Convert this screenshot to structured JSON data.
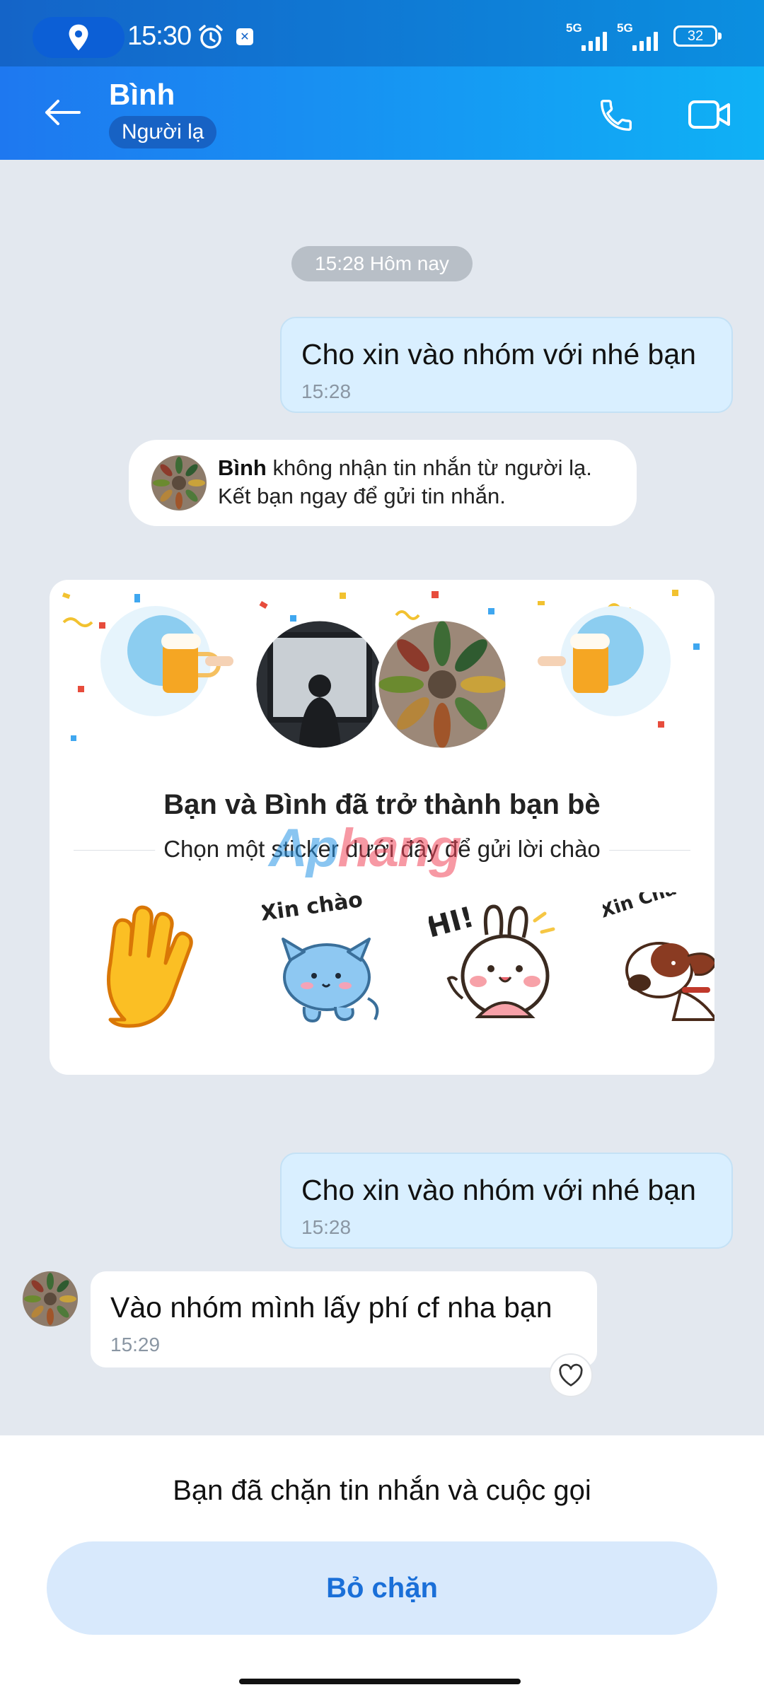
{
  "status_bar": {
    "time": "15:30",
    "network1": "5G",
    "network2": "5G",
    "battery": "32",
    "icons": [
      "location-icon",
      "alarm-icon",
      "notification-icon"
    ]
  },
  "header": {
    "name": "Bình",
    "badge": "Người lạ",
    "icons": [
      "back-arrow-icon",
      "phone-icon",
      "video-call-icon"
    ]
  },
  "chat": {
    "date_label": "15:28 Hôm nay",
    "messages": [
      {
        "side": "out",
        "text": "Cho xin vào nhóm với nhé bạn",
        "time": "15:28"
      },
      {
        "side": "out",
        "text": "Cho xin vào nhóm với nhé bạn",
        "time": "15:28"
      },
      {
        "side": "in",
        "text": "Vào nhóm mình lấy phí cf nha bạn",
        "time": "15:29"
      }
    ],
    "notice": {
      "name": "Bình",
      "line1_rest": " không nhận tin nhắn từ người lạ.",
      "line2": "Kết bạn ngay để gửi tin nhắn."
    },
    "friend_card": {
      "title": "Bạn và Bình đã trở thành bạn bè",
      "subtitle": "Chọn một sticker dưới đây để gửi lời chào",
      "watermark_a": "Ap",
      "watermark_b": "hang",
      "stickers": [
        {
          "name": "waving-hand",
          "caption": ""
        },
        {
          "name": "cat-xin-chao",
          "caption": "Xin chào"
        },
        {
          "name": "bunny-hi",
          "caption": "HI!"
        },
        {
          "name": "dog-xin-chao",
          "caption": "Xin Chào"
        }
      ]
    }
  },
  "bottom": {
    "blocked_text": "Bạn đã chặn tin nhắn và cuộc gọi",
    "unblock_label": "Bỏ chặn"
  },
  "colors": {
    "header_start": "#1e78f0",
    "header_end": "#0fb1f5",
    "outgoing_bubble": "#d9efff",
    "chat_bg": "#e3e8ef",
    "unblock_bg": "#d8e9fc",
    "unblock_text": "#1a6fd8"
  }
}
